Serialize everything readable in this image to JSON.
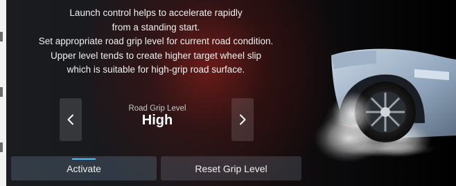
{
  "description_lines": [
    "Launch control helps to accelerate rapidly",
    "from a standing start.",
    "Set appropriate road grip level for current road condition.",
    "Upper level tends to create higher target wheel slip",
    "which is suitable for high-grip road surface."
  ],
  "grip": {
    "label": "Road Grip Level",
    "value": "High",
    "prev_icon": "chevron-left-icon",
    "next_icon": "chevron-right-icon"
  },
  "buttons": {
    "activate": "Activate",
    "reset": "Reset Grip Level"
  },
  "colors": {
    "accent": "#4fc3f7",
    "background_glow": "#781c18",
    "text": "#f1f1f1"
  }
}
